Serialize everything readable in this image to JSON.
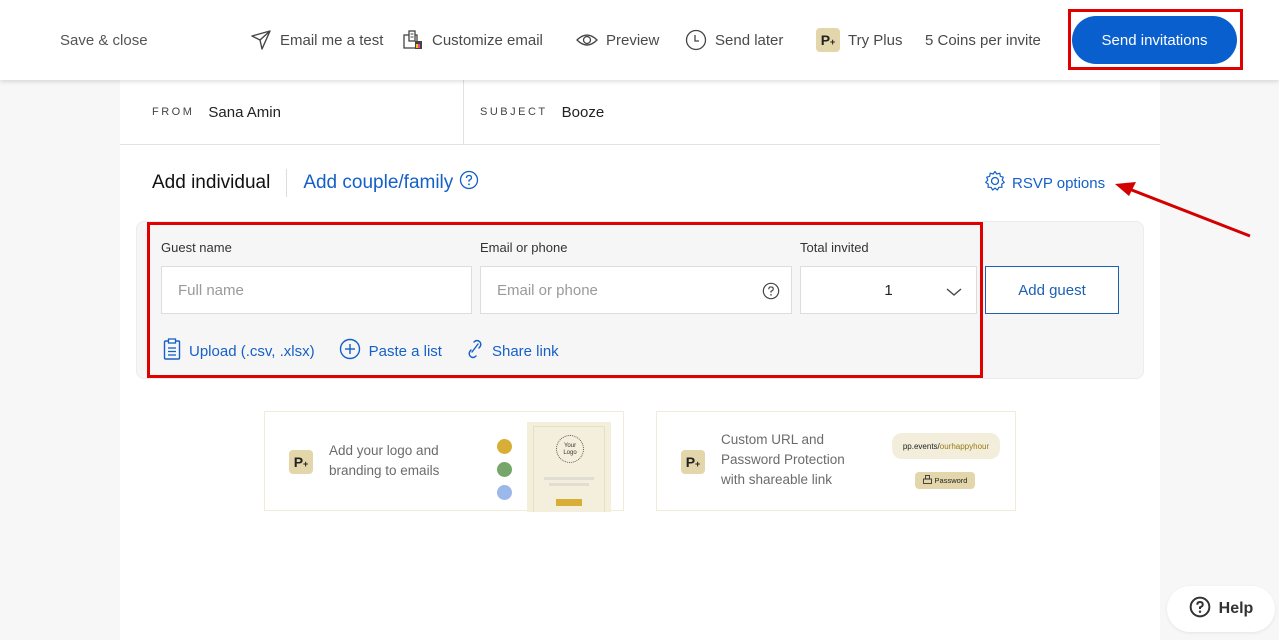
{
  "topbar": {
    "save_close": "Save & close",
    "email_test": "Email me a test",
    "customize_email": "Customize email",
    "preview": "Preview",
    "send_later": "Send later",
    "try_plus": "Try Plus",
    "plus_badge": "P",
    "coins": "5 Coins per invite",
    "send_invitations": "Send invitations"
  },
  "header": {
    "from_label": "FROM",
    "from_value": "Sana Amin",
    "subject_label": "SUBJECT",
    "subject_value": "Booze"
  },
  "tabs": {
    "add_individual": "Add individual",
    "add_couple_family": "Add couple/family",
    "rsvp_options": "RSVP options"
  },
  "guest_form": {
    "name_label": "Guest name",
    "name_placeholder": "Full name",
    "name_value": "",
    "contact_label": "Email or phone",
    "contact_placeholder": "Email or phone",
    "contact_value": "",
    "total_label": "Total invited",
    "total_value": "1",
    "add_guest": "Add guest",
    "upload": "Upload (.csv, .xlsx)",
    "paste_list": "Paste a list",
    "share_link": "Share link"
  },
  "promos": [
    {
      "line1": "Add your logo and",
      "line2": "branding to emails",
      "logo_text_1": "Your",
      "logo_text_2": "Logo"
    },
    {
      "line1": "Custom URL and",
      "line2": "Password Protection",
      "line3": "with shareable link",
      "url_prefix": "pp.events/",
      "url_slug": "ourhappyhour",
      "password_label": "Password"
    }
  ],
  "help": "Help",
  "colors": {
    "accent": "#0a5fcf",
    "link": "#1560c8",
    "plus_badge": "#e2d6aa",
    "highlight_red": "#e00000"
  }
}
